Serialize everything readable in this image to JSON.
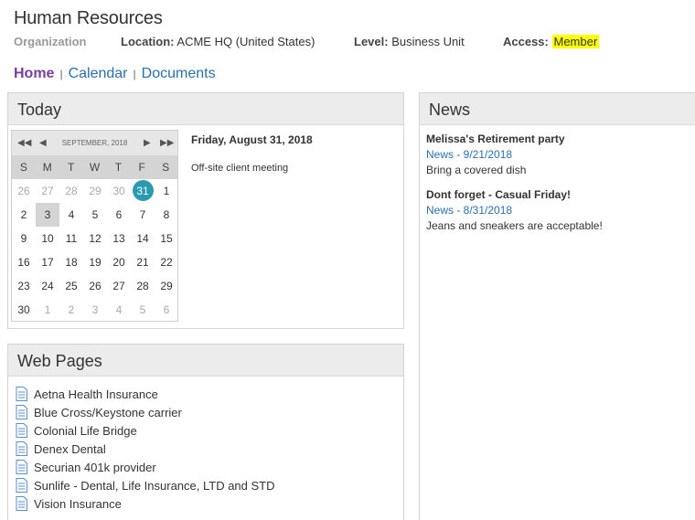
{
  "header": {
    "title": "Human Resources",
    "org_label": "Organization",
    "location_label": "Location:",
    "location_value": "ACME HQ (United States)",
    "level_label": "Level:",
    "level_value": "Business Unit",
    "access_label": "Access:",
    "access_value": "Member"
  },
  "nav": {
    "home": "Home",
    "sep": "|",
    "calendar": "Calendar",
    "documents": "Documents"
  },
  "today": {
    "title": "Today",
    "calendar": {
      "nav_first": "◀◀",
      "nav_prev": "◀",
      "month": "SEPTEMBER, 2018",
      "nav_next": "▶",
      "nav_last": "▶▶",
      "weekdays": [
        "S",
        "M",
        "T",
        "W",
        "T",
        "F",
        "S"
      ],
      "days": [
        "26",
        "27",
        "28",
        "29",
        "30",
        "31",
        "1",
        "2",
        "3",
        "4",
        "5",
        "6",
        "7",
        "8",
        "9",
        "10",
        "11",
        "12",
        "13",
        "14",
        "15",
        "16",
        "17",
        "18",
        "19",
        "20",
        "21",
        "22",
        "23",
        "24",
        "25",
        "26",
        "27",
        "28",
        "29",
        "30",
        "1",
        "2",
        "3",
        "4",
        "5",
        "6"
      ]
    },
    "date_heading": "Friday, August 31, 2018",
    "event": "Off-site client meeting"
  },
  "webpages": {
    "title": "Web Pages",
    "items": [
      "Aetna Health Insurance",
      "Blue Cross/Keystone carrier",
      "Colonial Life Bridge",
      "Denex Dental",
      "Securian 401k provider",
      "Sunlife - Dental, Life Insurance, LTD and STD",
      "Vision Insurance"
    ]
  },
  "news": {
    "title": "News",
    "items": [
      {
        "title": "Melissa's Retirement party",
        "link": "News - 9/21/2018",
        "body": "Bring a covered dish"
      },
      {
        "title": "Dont forget - Casual Friday!",
        "link": "News - 8/31/2018",
        "body": "Jeans and sneakers are acceptable!"
      }
    ]
  },
  "colors": {
    "accent_link": "#2a6fb0",
    "home_link": "#7b3ea0",
    "today_circle": "#2a9ab0",
    "highlight": "#ffff00"
  }
}
